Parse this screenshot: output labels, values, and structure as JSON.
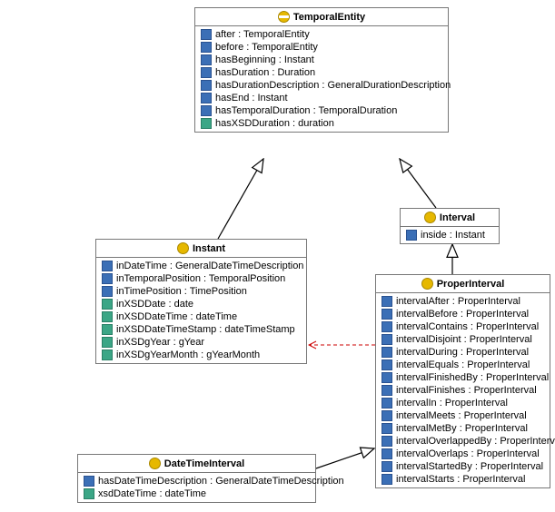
{
  "classes": {
    "temporalEntity": {
      "title": "TemporalEntity",
      "props": [
        {
          "kind": "blue",
          "label": "after : TemporalEntity"
        },
        {
          "kind": "blue",
          "label": "before : TemporalEntity"
        },
        {
          "kind": "blue",
          "label": "hasBeginning : Instant"
        },
        {
          "kind": "blue",
          "label": "hasDuration : Duration"
        },
        {
          "kind": "blue",
          "label": "hasDurationDescription : GeneralDurationDescription"
        },
        {
          "kind": "blue",
          "label": "hasEnd : Instant"
        },
        {
          "kind": "blue",
          "label": "hasTemporalDuration : TemporalDuration"
        },
        {
          "kind": "green",
          "label": "hasXSDDuration : duration"
        }
      ]
    },
    "instant": {
      "title": "Instant",
      "props": [
        {
          "kind": "blue",
          "label": "inDateTime : GeneralDateTimeDescription"
        },
        {
          "kind": "blue",
          "label": "inTemporalPosition : TemporalPosition"
        },
        {
          "kind": "blue",
          "label": "inTimePosition : TimePosition"
        },
        {
          "kind": "green",
          "label": "inXSDDate : date"
        },
        {
          "kind": "green",
          "label": "inXSDDateTime : dateTime"
        },
        {
          "kind": "green",
          "label": "inXSDDateTimeStamp : dateTimeStamp"
        },
        {
          "kind": "green",
          "label": "inXSDgYear : gYear"
        },
        {
          "kind": "green",
          "label": "inXSDgYearMonth : gYearMonth"
        }
      ]
    },
    "interval": {
      "title": "Interval",
      "props": [
        {
          "kind": "blue",
          "label": "inside : Instant"
        }
      ]
    },
    "properInterval": {
      "title": "ProperInterval",
      "props": [
        {
          "kind": "blue",
          "label": "intervalAfter : ProperInterval"
        },
        {
          "kind": "blue",
          "label": "intervalBefore : ProperInterval"
        },
        {
          "kind": "blue",
          "label": "intervalContains : ProperInterval"
        },
        {
          "kind": "blue",
          "label": "intervalDisjoint : ProperInterval"
        },
        {
          "kind": "blue",
          "label": "intervalDuring : ProperInterval"
        },
        {
          "kind": "blue",
          "label": "intervalEquals : ProperInterval"
        },
        {
          "kind": "blue",
          "label": "intervalFinishedBy : ProperInterval"
        },
        {
          "kind": "blue",
          "label": "intervalFinishes : ProperInterval"
        },
        {
          "kind": "blue",
          "label": "intervalIn : ProperInterval"
        },
        {
          "kind": "blue",
          "label": "intervalMeets : ProperInterval"
        },
        {
          "kind": "blue",
          "label": "intervalMetBy : ProperInterval"
        },
        {
          "kind": "blue",
          "label": "intervalOverlappedBy : ProperInterval"
        },
        {
          "kind": "blue",
          "label": "intervalOverlaps : ProperInterval"
        },
        {
          "kind": "blue",
          "label": "intervalStartedBy : ProperInterval"
        },
        {
          "kind": "blue",
          "label": "intervalStarts : ProperInterval"
        }
      ]
    },
    "dateTimeInterval": {
      "title": "DateTimeInterval",
      "props": [
        {
          "kind": "blue",
          "label": "hasDateTimeDescription : GeneralDateTimeDescription"
        },
        {
          "kind": "green",
          "label": "xsdDateTime : dateTime"
        }
      ]
    }
  }
}
